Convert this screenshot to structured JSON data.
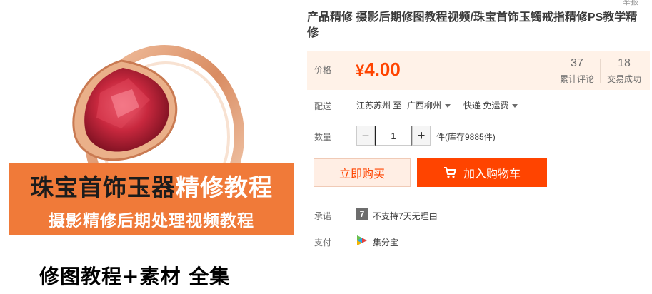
{
  "image": {
    "banner_line1_dark": "珠宝首饰玉器",
    "banner_line1_light": "精修教程",
    "banner_line2": "摄影精修后期处理视频教程",
    "bottom_text": "修图教程+素材 全集",
    "colors": {
      "banner": "#f07a39",
      "gem": "#c8283e",
      "gold": "#e8a27a"
    }
  },
  "top_clipped_text": "举报",
  "product": {
    "title": "产品精修 摄影后期修图教程视频/珠宝首饰玉镯戒指精修PS教学精修"
  },
  "price": {
    "label": "价格",
    "currency": "¥",
    "amount": "4.00",
    "reviews_count": "37",
    "reviews_label": "累计评论",
    "sales_count": "18",
    "sales_label": "交易成功",
    "color": "#ff4400"
  },
  "delivery": {
    "label": "配送",
    "from": "江苏苏州 至",
    "to": "广西柳州",
    "method": "快递 免运费"
  },
  "quantity": {
    "label": "数量",
    "value": "1",
    "minus_symbol": "−",
    "plus_symbol": "+",
    "stock_text": "件(库存9885件)"
  },
  "actions": {
    "buy_now": "立即购买",
    "add_to_cart": "加入购物车"
  },
  "promise": {
    "label": "承诺",
    "icon_char": "7",
    "text": "不支持7天无理由"
  },
  "payment": {
    "label": "支付",
    "method": "集分宝"
  }
}
